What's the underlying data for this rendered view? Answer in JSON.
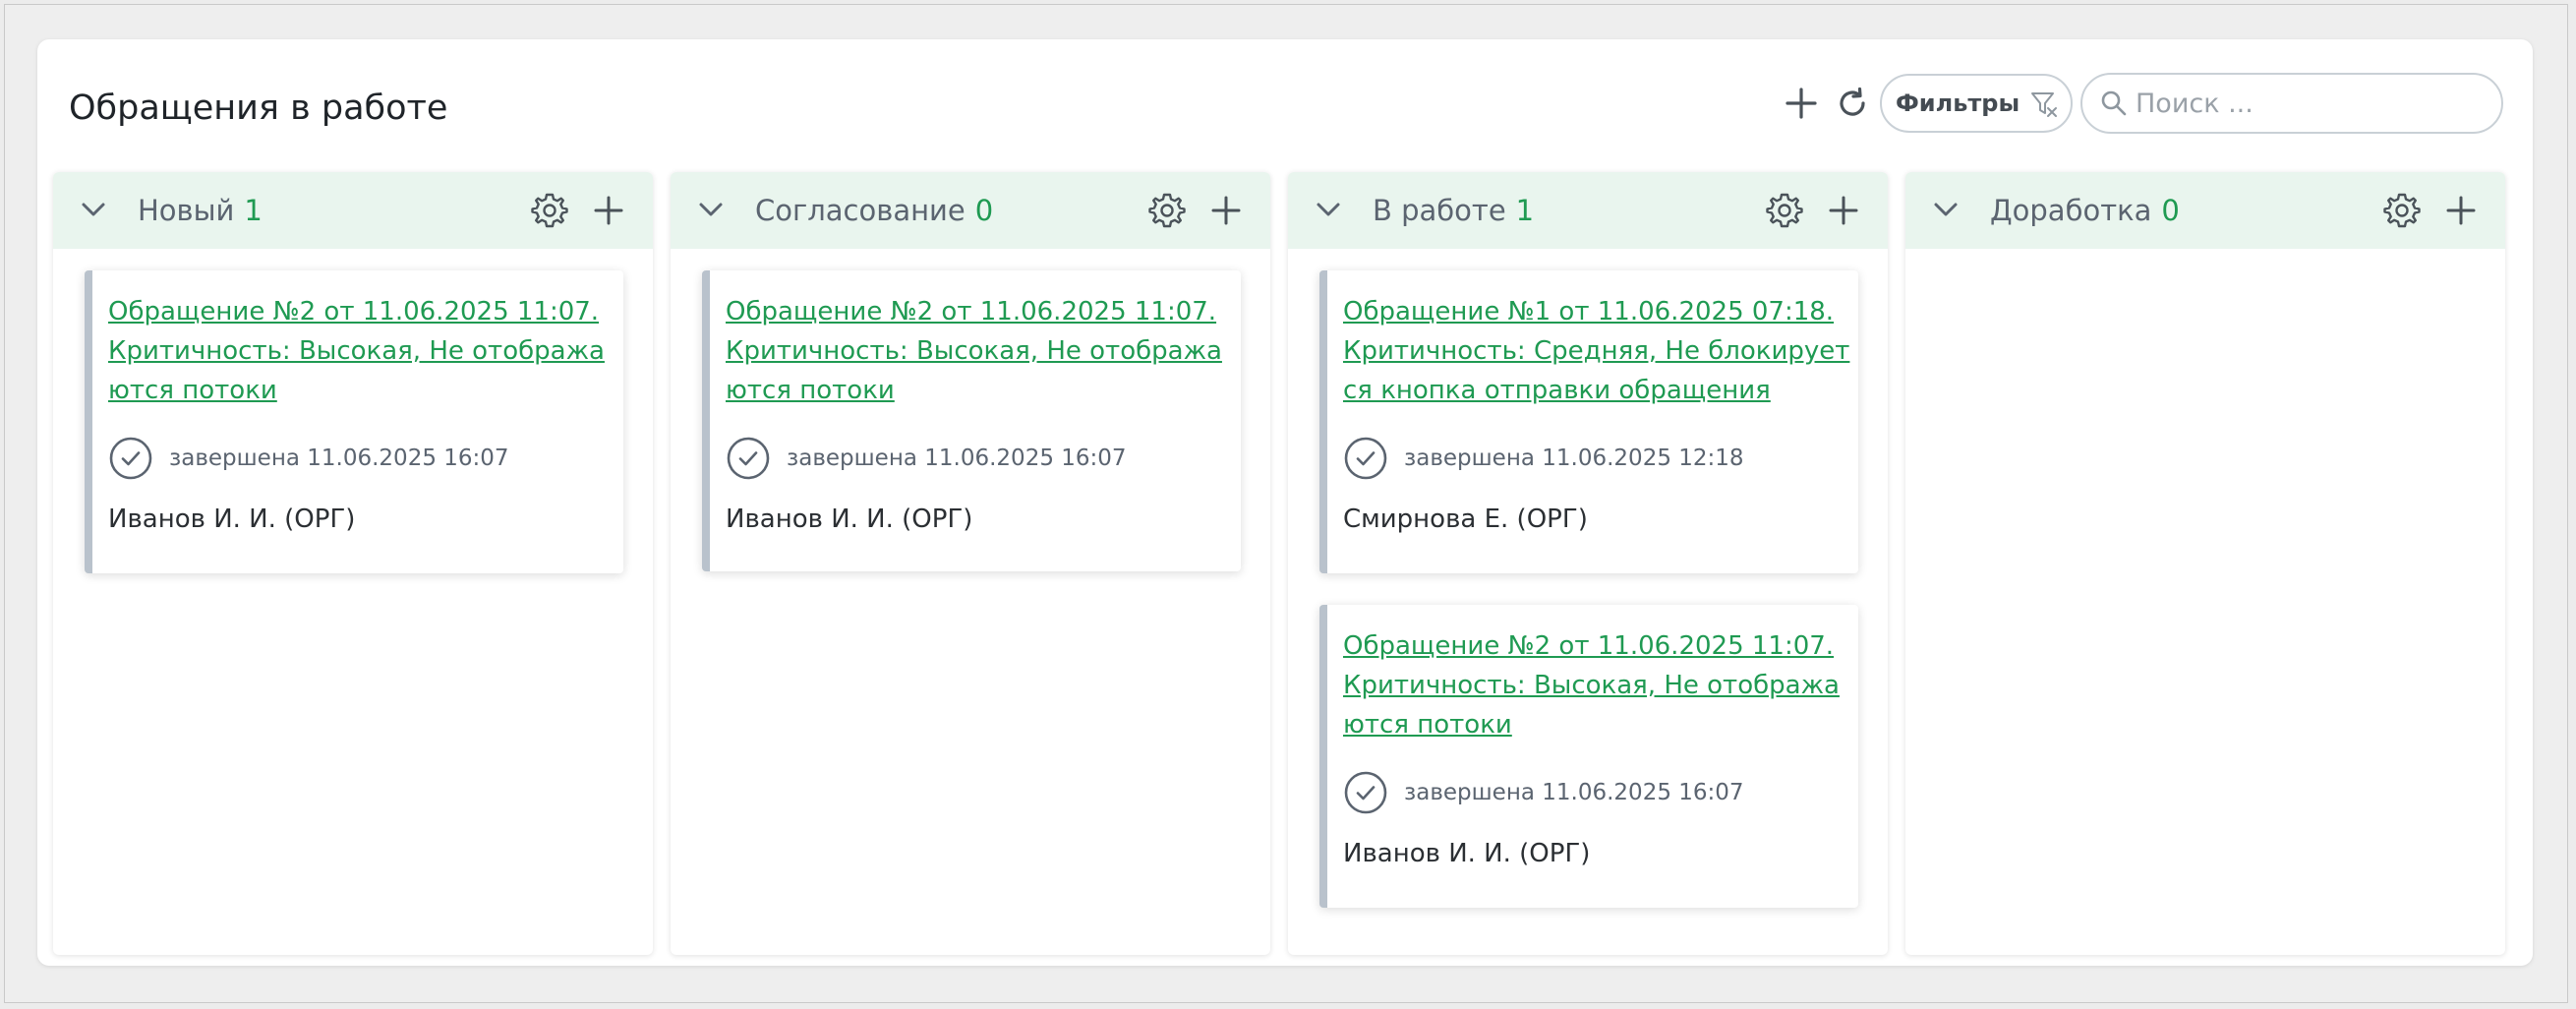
{
  "panel": {
    "title": "Обращения в работе"
  },
  "toolbar": {
    "add_icon": "plus-icon",
    "refresh_icon": "refresh-icon",
    "filters_label": "Фильтры",
    "filter_icon": "filter-clear-icon",
    "search_placeholder": "Поиск ...",
    "search_icon": "search-icon"
  },
  "colors": {
    "accent": "#1f9a52",
    "column_header_bg": "#e9f5ee",
    "card_border": "#b9c2cc"
  },
  "columns": [
    {
      "name": "Новый",
      "count": "1",
      "cards": [
        {
          "title": "Обращение №2 от 11.06.2025 11:07. Критичность: Высокая, Не отображаются потоки",
          "status": "завершена 11.06.2025 16:07",
          "author": "Иванов И. И. (ОРГ)"
        }
      ]
    },
    {
      "name": "Согласование",
      "count": "0",
      "cards": [
        {
          "title": "Обращение №2 от 11.06.2025 11:07. Критичность: Высокая, Не отображаются потоки",
          "status": "завершена 11.06.2025 16:07",
          "author": "Иванов И. И. (ОРГ)"
        }
      ]
    },
    {
      "name": "В работе",
      "count": "1",
      "cards": [
        {
          "title": "Обращение №1 от 11.06.2025 07:18. Критичность: Средняя, Не блокируется кнопка отправки обращения",
          "status": "завершена 11.06.2025 12:18",
          "author": "Смирнова Е. (ОРГ)"
        },
        {
          "title": "Обращение №2 от 11.06.2025 11:07. Критичность: Высокая, Не отображаются потоки",
          "status": "завершена 11.06.2025 16:07",
          "author": "Иванов И. И. (ОРГ)"
        }
      ]
    },
    {
      "name": "Доработка",
      "count": "0",
      "cards": []
    }
  ]
}
